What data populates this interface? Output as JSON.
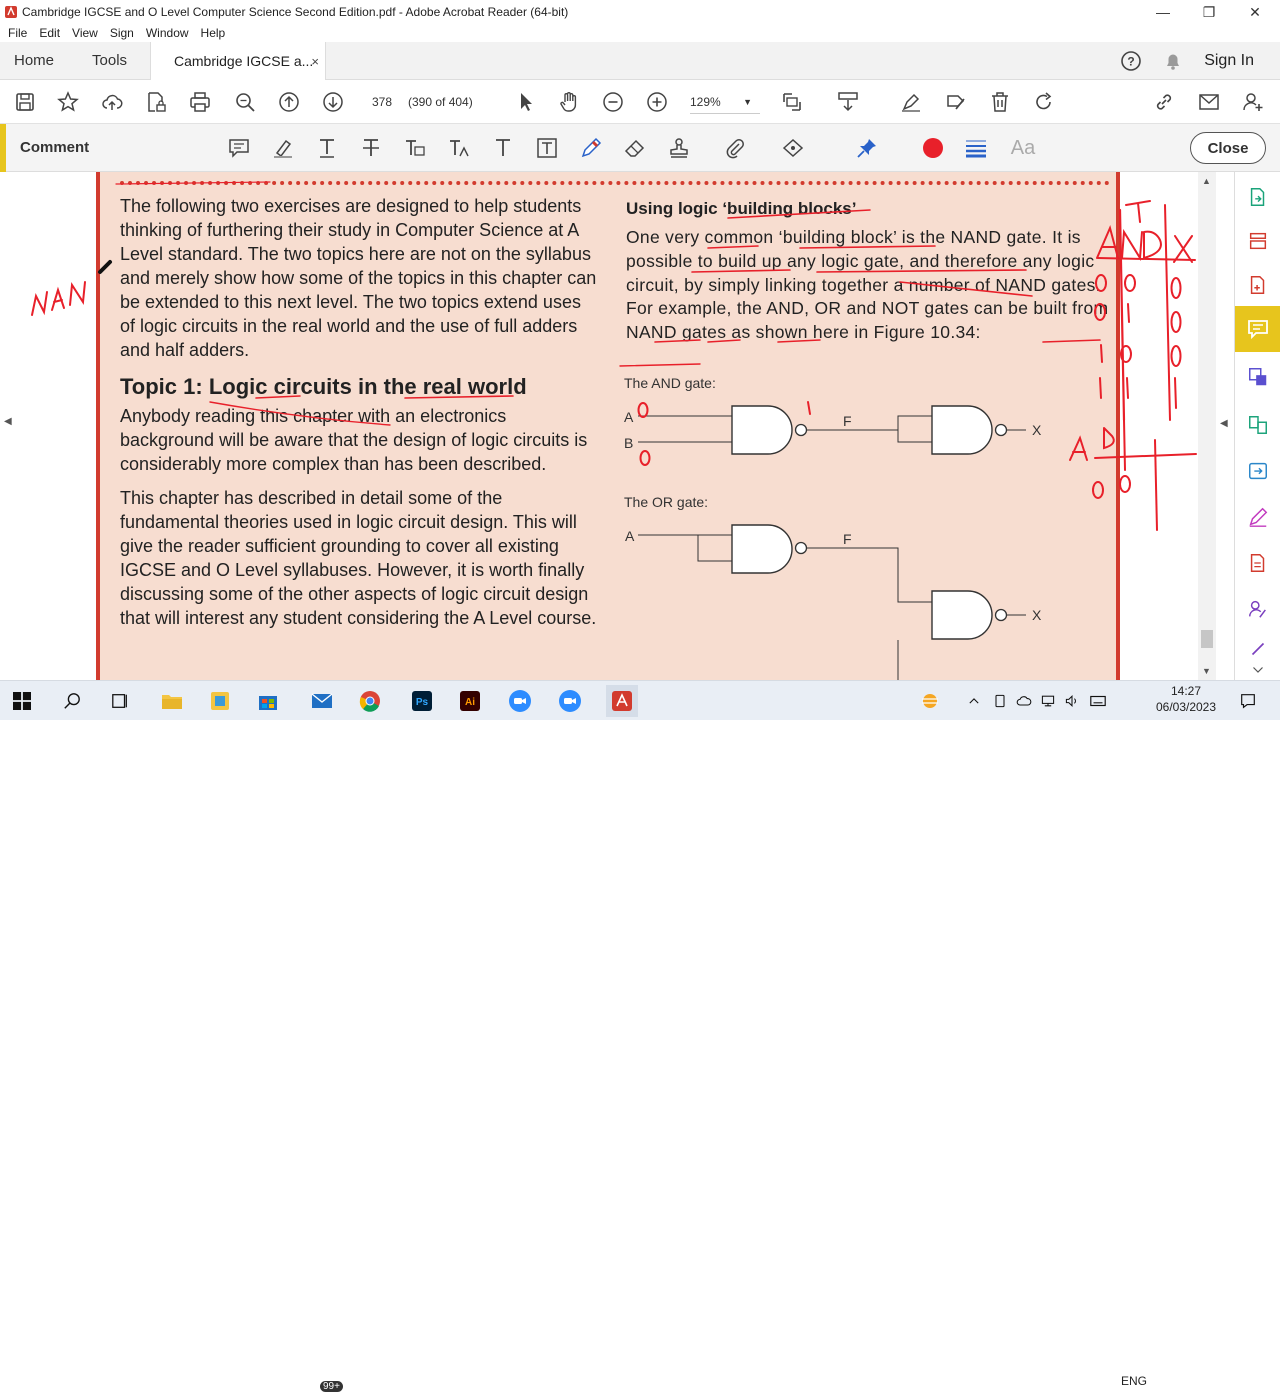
{
  "window": {
    "title": "Cambridge IGCSE and O Level Computer Science Second Edition.pdf - Adobe Acrobat Reader (64-bit)"
  },
  "menu": [
    "File",
    "Edit",
    "View",
    "Sign",
    "Window",
    "Help"
  ],
  "tabs": {
    "home": "Home",
    "tools": "Tools",
    "document": "Cambridge IGCSE a...",
    "close_glyph": "×",
    "sign_in": "Sign In"
  },
  "toolbar": {
    "page_number": "378",
    "page_count": "(390 of 404)",
    "zoom": "129%",
    "zoom_caret": "▼"
  },
  "comment_bar": {
    "label": "Comment",
    "close": "Close",
    "text_tool_glyph": "Aa"
  },
  "page": {
    "left_paragraph_1": "The following two exercises are designed to help students thinking of furthering their study in Computer Science at A Level standard. The two topics here are not on the syllabus and merely show how some of the topics in this chapter can be extended to this next level. The two topics extend uses of logic circuits in the real world and the use of full adders and half adders.",
    "topic_heading": "Topic 1: Logic circuits in the real world",
    "left_paragraph_2": "Anybody reading this chapter with an electronics background will be aware that the design of logic circuits is considerably more complex than has been described.",
    "left_paragraph_3": "This chapter has described in detail some of the fundamental theories used in logic circuit design. This will give the reader sufficient grounding to cover all existing IGCSE and O Level syllabuses. However, it is worth finally discussing some of the other aspects of logic circuit design that will interest any student considering the A Level course.",
    "right_heading": "Using logic ‘building blocks’",
    "right_paragraph": "One very common ‘building block’ is the NAND gate. It is possible to build up any logic gate, and therefore any logic circuit, by simply linking together a number of NAND gates. For example, the AND, OR and NOT gates can be built from NAND gates as shown here in Figure 10.34:",
    "and_caption": "The AND gate:",
    "or_caption": "The OR gate:",
    "labels": {
      "a": "A",
      "b": "B",
      "f": "F",
      "x": "X"
    }
  },
  "handwriting": {
    "margin_note": "NAN",
    "table_header": "AND",
    "col_x": "X",
    "col_t": "T",
    "zero": "0",
    "one": "1",
    "a_label": "A",
    "b_label": "B"
  },
  "taskbar": {
    "mail_badge": "99+",
    "language": "ENG",
    "time": "14:27",
    "date": "06/03/2023"
  },
  "colors": {
    "accent": "#e7c51d",
    "acrobat_red": "#d23b2e",
    "page_tint": "#f7ddd0",
    "ink": "#e8202a"
  }
}
